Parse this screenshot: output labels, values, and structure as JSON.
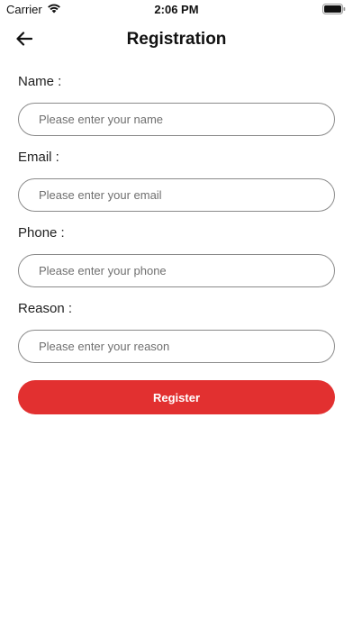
{
  "status_bar": {
    "carrier": "Carrier",
    "time": "2:06 PM"
  },
  "header": {
    "title": "Registration",
    "back_icon": "arrow-left-icon"
  },
  "form": {
    "name": {
      "label": "Name :",
      "placeholder": "Please enter your name",
      "value": ""
    },
    "email": {
      "label": "Email :",
      "placeholder": "Please enter your email",
      "value": ""
    },
    "phone": {
      "label": "Phone :",
      "placeholder": "Please enter your phone",
      "value": ""
    },
    "reason": {
      "label": "Reason :",
      "placeholder": "Please enter your reason",
      "value": ""
    },
    "submit_label": "Register"
  },
  "colors": {
    "accent": "#e23030",
    "input_border": "#8a8a8a"
  }
}
